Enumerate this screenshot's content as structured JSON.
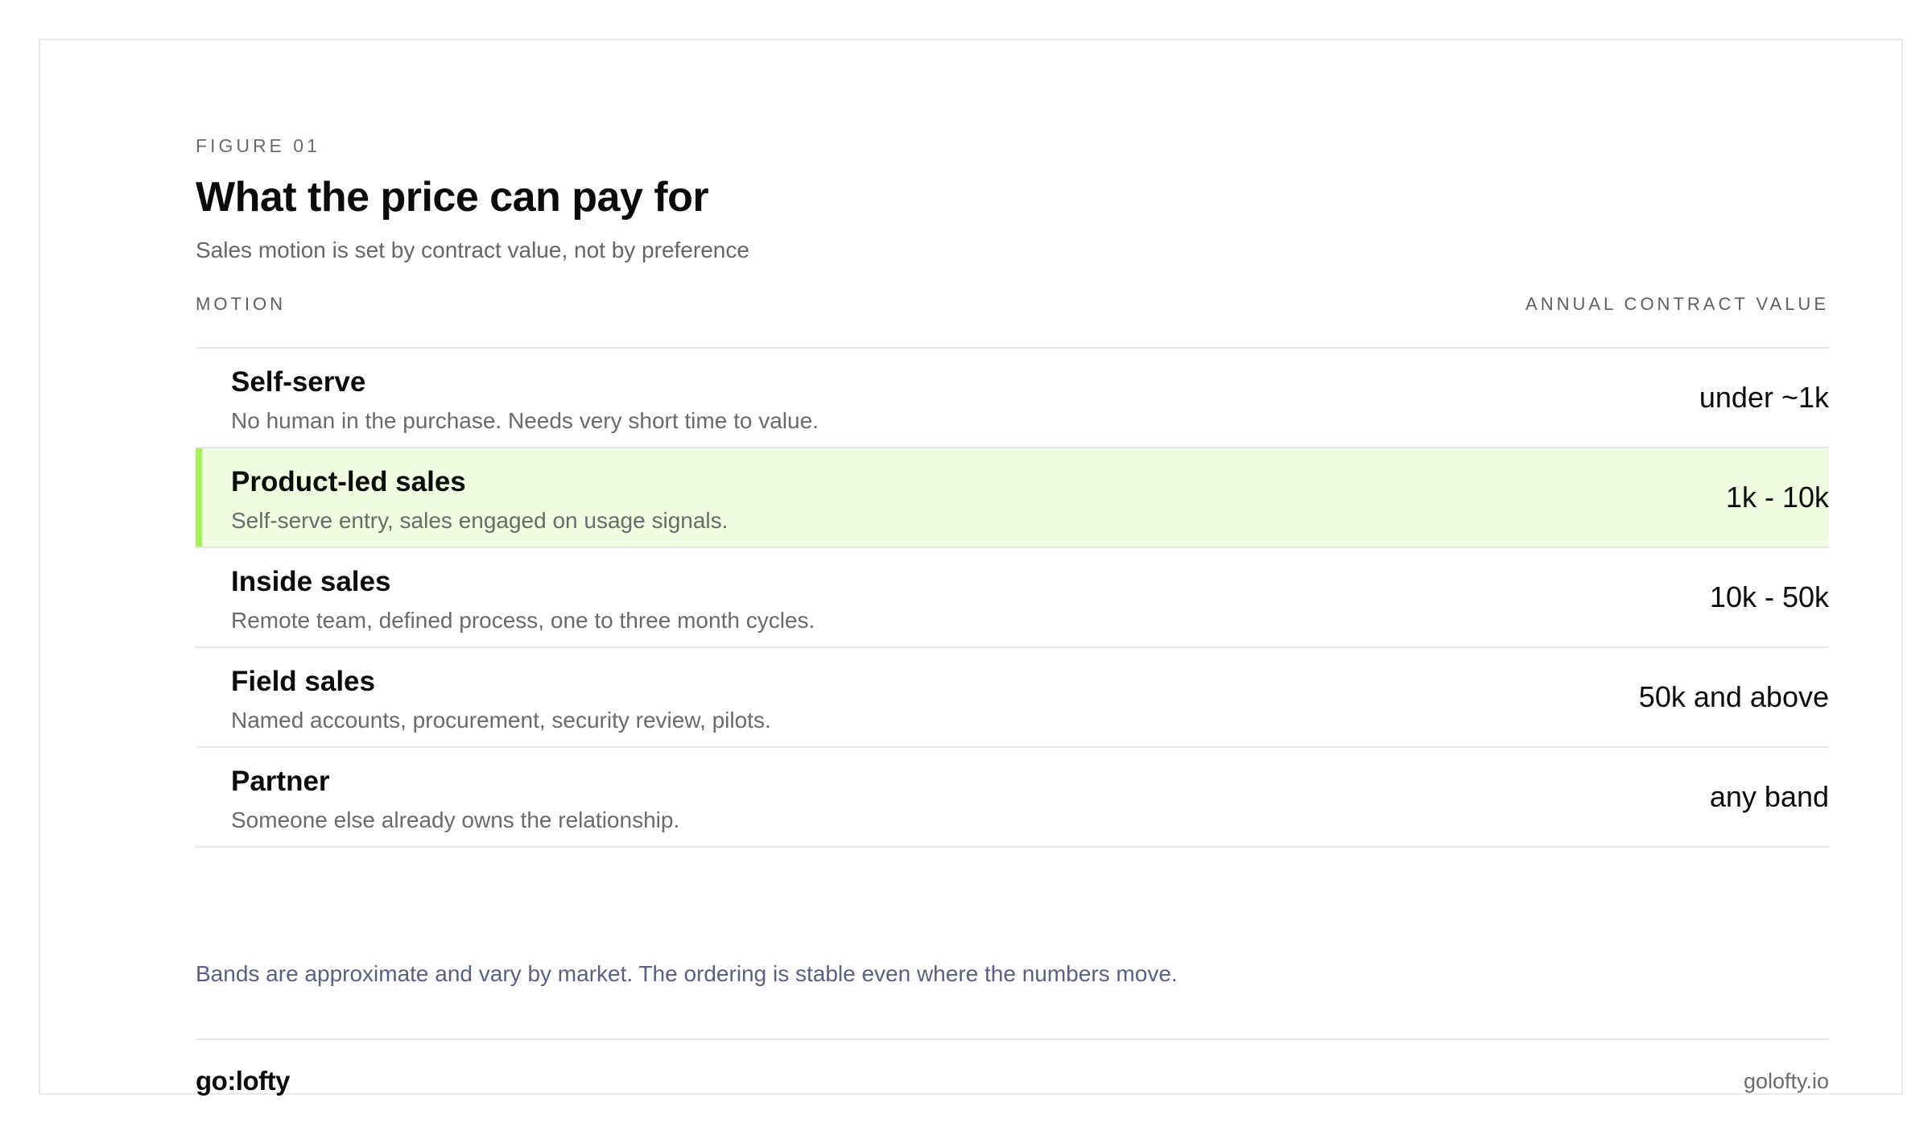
{
  "figure": {
    "eyebrow": "FIGURE 01",
    "title": "What the price can pay for",
    "subtitle": "Sales motion is set by contract value, not by preference"
  },
  "table": {
    "headers": {
      "left": "MOTION",
      "right": "ANNUAL CONTRACT VALUE"
    },
    "rows": [
      {
        "name": "Self-serve",
        "desc": "No human in the purchase. Needs very short time to value.",
        "value": "under ~1k",
        "highlighted": false
      },
      {
        "name": "Product-led sales",
        "desc": "Self-serve entry, sales engaged on usage signals.",
        "value": "1k - 10k",
        "highlighted": true
      },
      {
        "name": "Inside sales",
        "desc": "Remote team, defined process, one to three month cycles.",
        "value": "10k - 50k",
        "highlighted": false
      },
      {
        "name": "Field sales",
        "desc": "Named accounts, procurement, security review, pilots.",
        "value": "50k and above",
        "highlighted": false
      },
      {
        "name": "Partner",
        "desc": "Someone else already owns the relationship.",
        "value": "any band",
        "highlighted": false
      }
    ]
  },
  "note": "Bands are approximate and vary by market. The ordering is stable even where the numbers move.",
  "footer": {
    "brand": "go:lofty",
    "site": "golofty.io"
  },
  "colors": {
    "highlight_bg": "#f0fcdf",
    "highlight_accent": "#a4f25a",
    "note_text": "#5b5e86"
  }
}
